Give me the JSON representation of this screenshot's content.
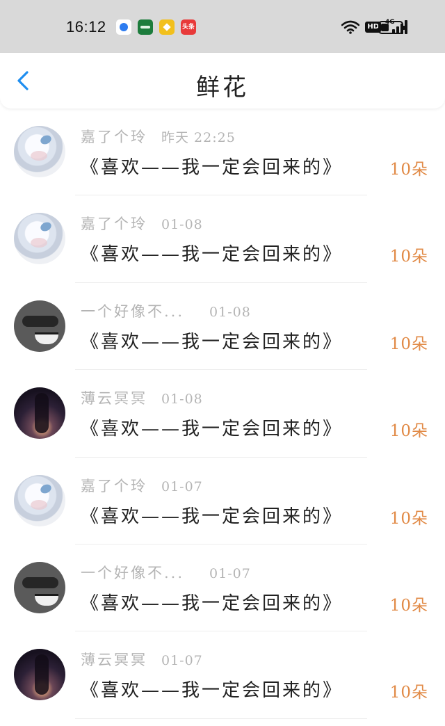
{
  "status_bar": {
    "time": "16:12",
    "notification_icons": [
      "app-circle-icon",
      "app-green-icon",
      "app-diamond-icon",
      "toutiao-icon"
    ],
    "toutiao_label": "头条",
    "hd_label": "HD",
    "network_label": "4G",
    "battery_level": 0.4
  },
  "header": {
    "title": "鲜花",
    "back_icon": "chevron-left-icon",
    "accent_color": "#1e8ef0"
  },
  "items": [
    {
      "user": "嘉了个玲",
      "time": "昨天 22:25",
      "avatar": "girl",
      "gift": "《喜欢——我一定会回来的》",
      "count": "10朵"
    },
    {
      "user": "嘉了个玲",
      "time": "01-08",
      "avatar": "girl",
      "gift": "《喜欢——我一定会回来的》",
      "count": "10朵"
    },
    {
      "user": "一个好像不...",
      "time": "01-08",
      "avatar": "dog",
      "gift": "《喜欢——我一定会回来的》",
      "count": "10朵"
    },
    {
      "user": "薄云冥冥",
      "time": "01-08",
      "avatar": "night",
      "gift": "《喜欢——我一定会回来的》",
      "count": "10朵"
    },
    {
      "user": "嘉了个玲",
      "time": "01-07",
      "avatar": "girl",
      "gift": "《喜欢——我一定会回来的》",
      "count": "10朵"
    },
    {
      "user": "一个好像不...",
      "time": "01-07",
      "avatar": "dog",
      "gift": "《喜欢——我一定会回来的》",
      "count": "10朵"
    },
    {
      "user": "薄云冥冥",
      "time": "01-07",
      "avatar": "night",
      "gift": "《喜欢——我一定会回来的》",
      "count": "10朵"
    }
  ],
  "colors": {
    "count": "#e18a46",
    "meta": "#b4b4b4",
    "status_bar_bg": "#d9d9d9"
  }
}
